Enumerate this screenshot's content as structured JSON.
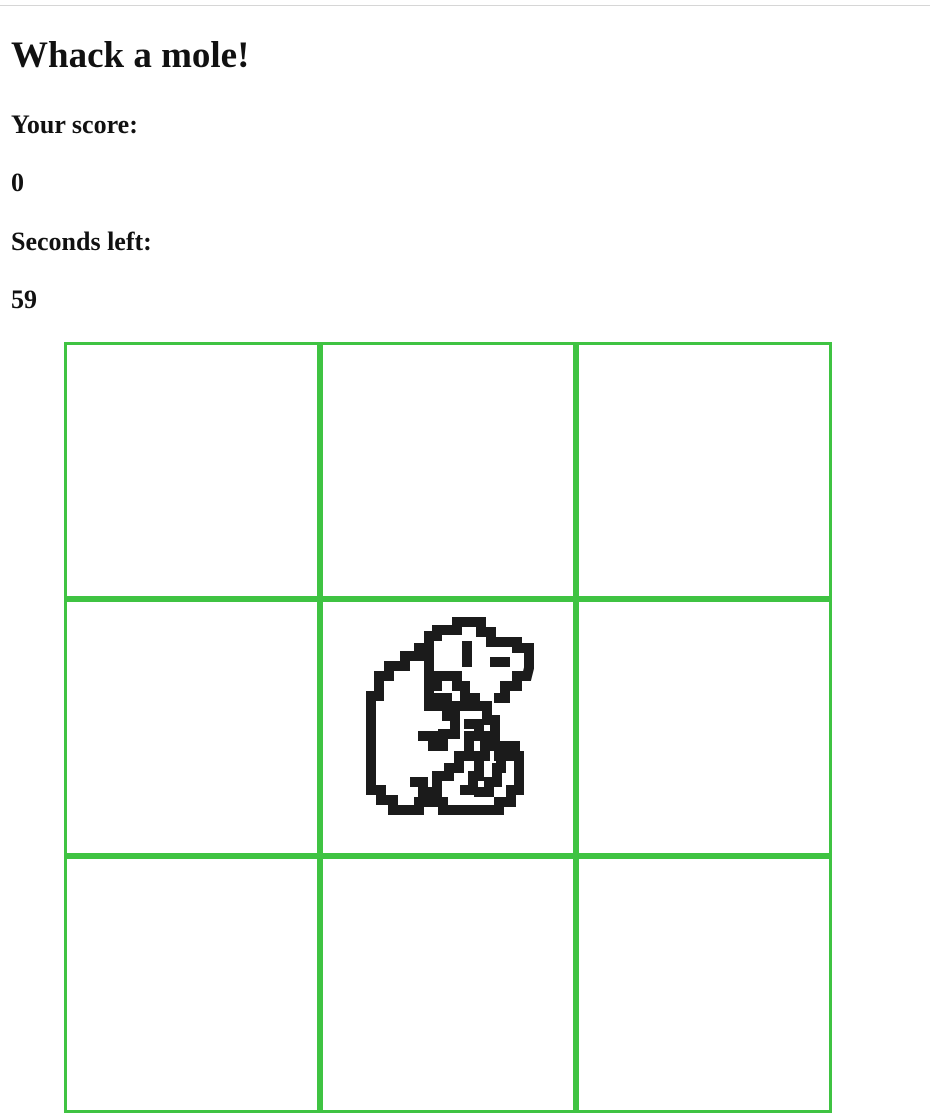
{
  "game": {
    "title": "Whack a mole!",
    "score_label": "Your score:",
    "score_value": "0",
    "seconds_label": "Seconds left:",
    "seconds_value": "59"
  },
  "board": {
    "columns": 3,
    "visible_rows": 3,
    "mole_cell_index": 4,
    "mole_icon": "mole-icon",
    "border_color": "#3fc342"
  }
}
